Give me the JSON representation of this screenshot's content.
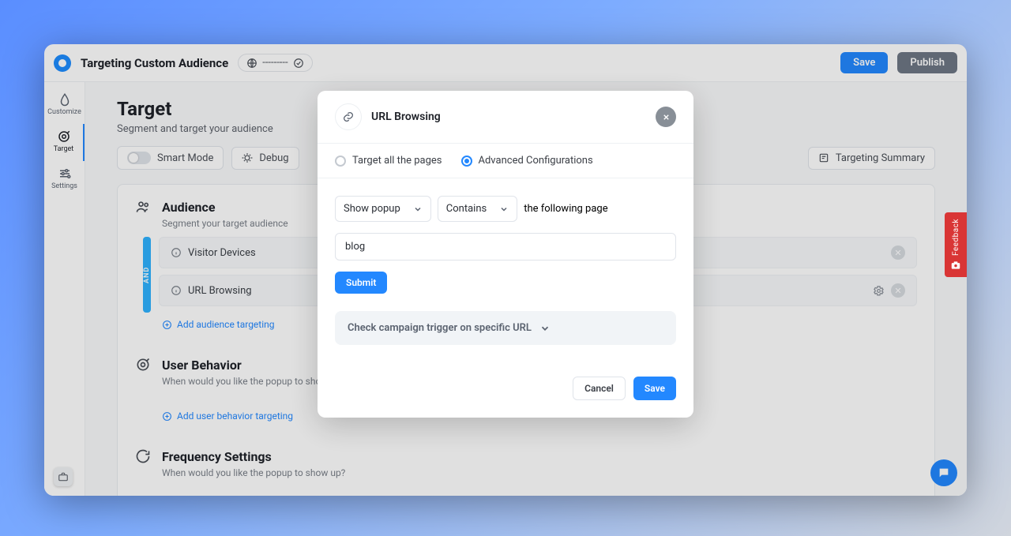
{
  "topbar": {
    "title": "Targeting Custom Audience",
    "status_text": "---------",
    "save": "Save",
    "publish": "Publish"
  },
  "sidenav": {
    "items": [
      {
        "label": "Customize"
      },
      {
        "label": "Target"
      },
      {
        "label": "Settings"
      }
    ]
  },
  "page": {
    "heading": "Target",
    "subheading": "Segment and target your audience",
    "smart_mode": "Smart Mode",
    "debug": "Debug",
    "targeting_summary": "Targeting Summary"
  },
  "sections": {
    "audience": {
      "title": "Audience",
      "sub": "Segment your target audience",
      "and_label": "AND",
      "rules": [
        {
          "label": "Visitor Devices"
        },
        {
          "label": "URL Browsing"
        }
      ],
      "add_link": "Add audience targeting"
    },
    "behavior": {
      "title": "User Behavior",
      "sub": "When would you like the popup to show up?",
      "add_link": "Add user behavior targeting"
    },
    "frequency": {
      "title": "Frequency Settings",
      "sub": "When would you like the popup to show up?"
    }
  },
  "modal": {
    "title": "URL Browsing",
    "radio_all": "Target all the pages",
    "radio_adv": "Advanced Configurations",
    "select_action": "Show popup",
    "select_match": "Contains",
    "following_text": "the following page",
    "input_value": "blog",
    "submit": "Submit",
    "check_trigger": "Check campaign trigger on specific URL",
    "cancel": "Cancel",
    "save": "Save"
  },
  "feedback": {
    "label": "Feedback"
  }
}
